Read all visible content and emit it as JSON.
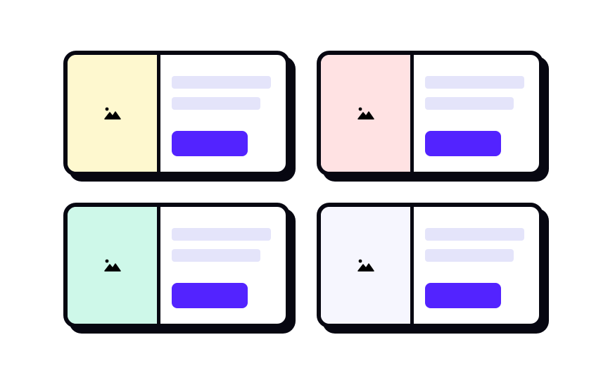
{
  "colors": {
    "outline": "#070711",
    "placeholder_line": "#e4e4fa",
    "button": "#5323ff"
  },
  "cards": [
    {
      "media_color": "#fef8cf",
      "icon": "image-icon"
    },
    {
      "media_color": "#ffe2e3",
      "icon": "image-icon"
    },
    {
      "media_color": "#cef8e9",
      "icon": "image-icon"
    },
    {
      "media_color": "#f6f6fe",
      "icon": "image-icon"
    }
  ]
}
